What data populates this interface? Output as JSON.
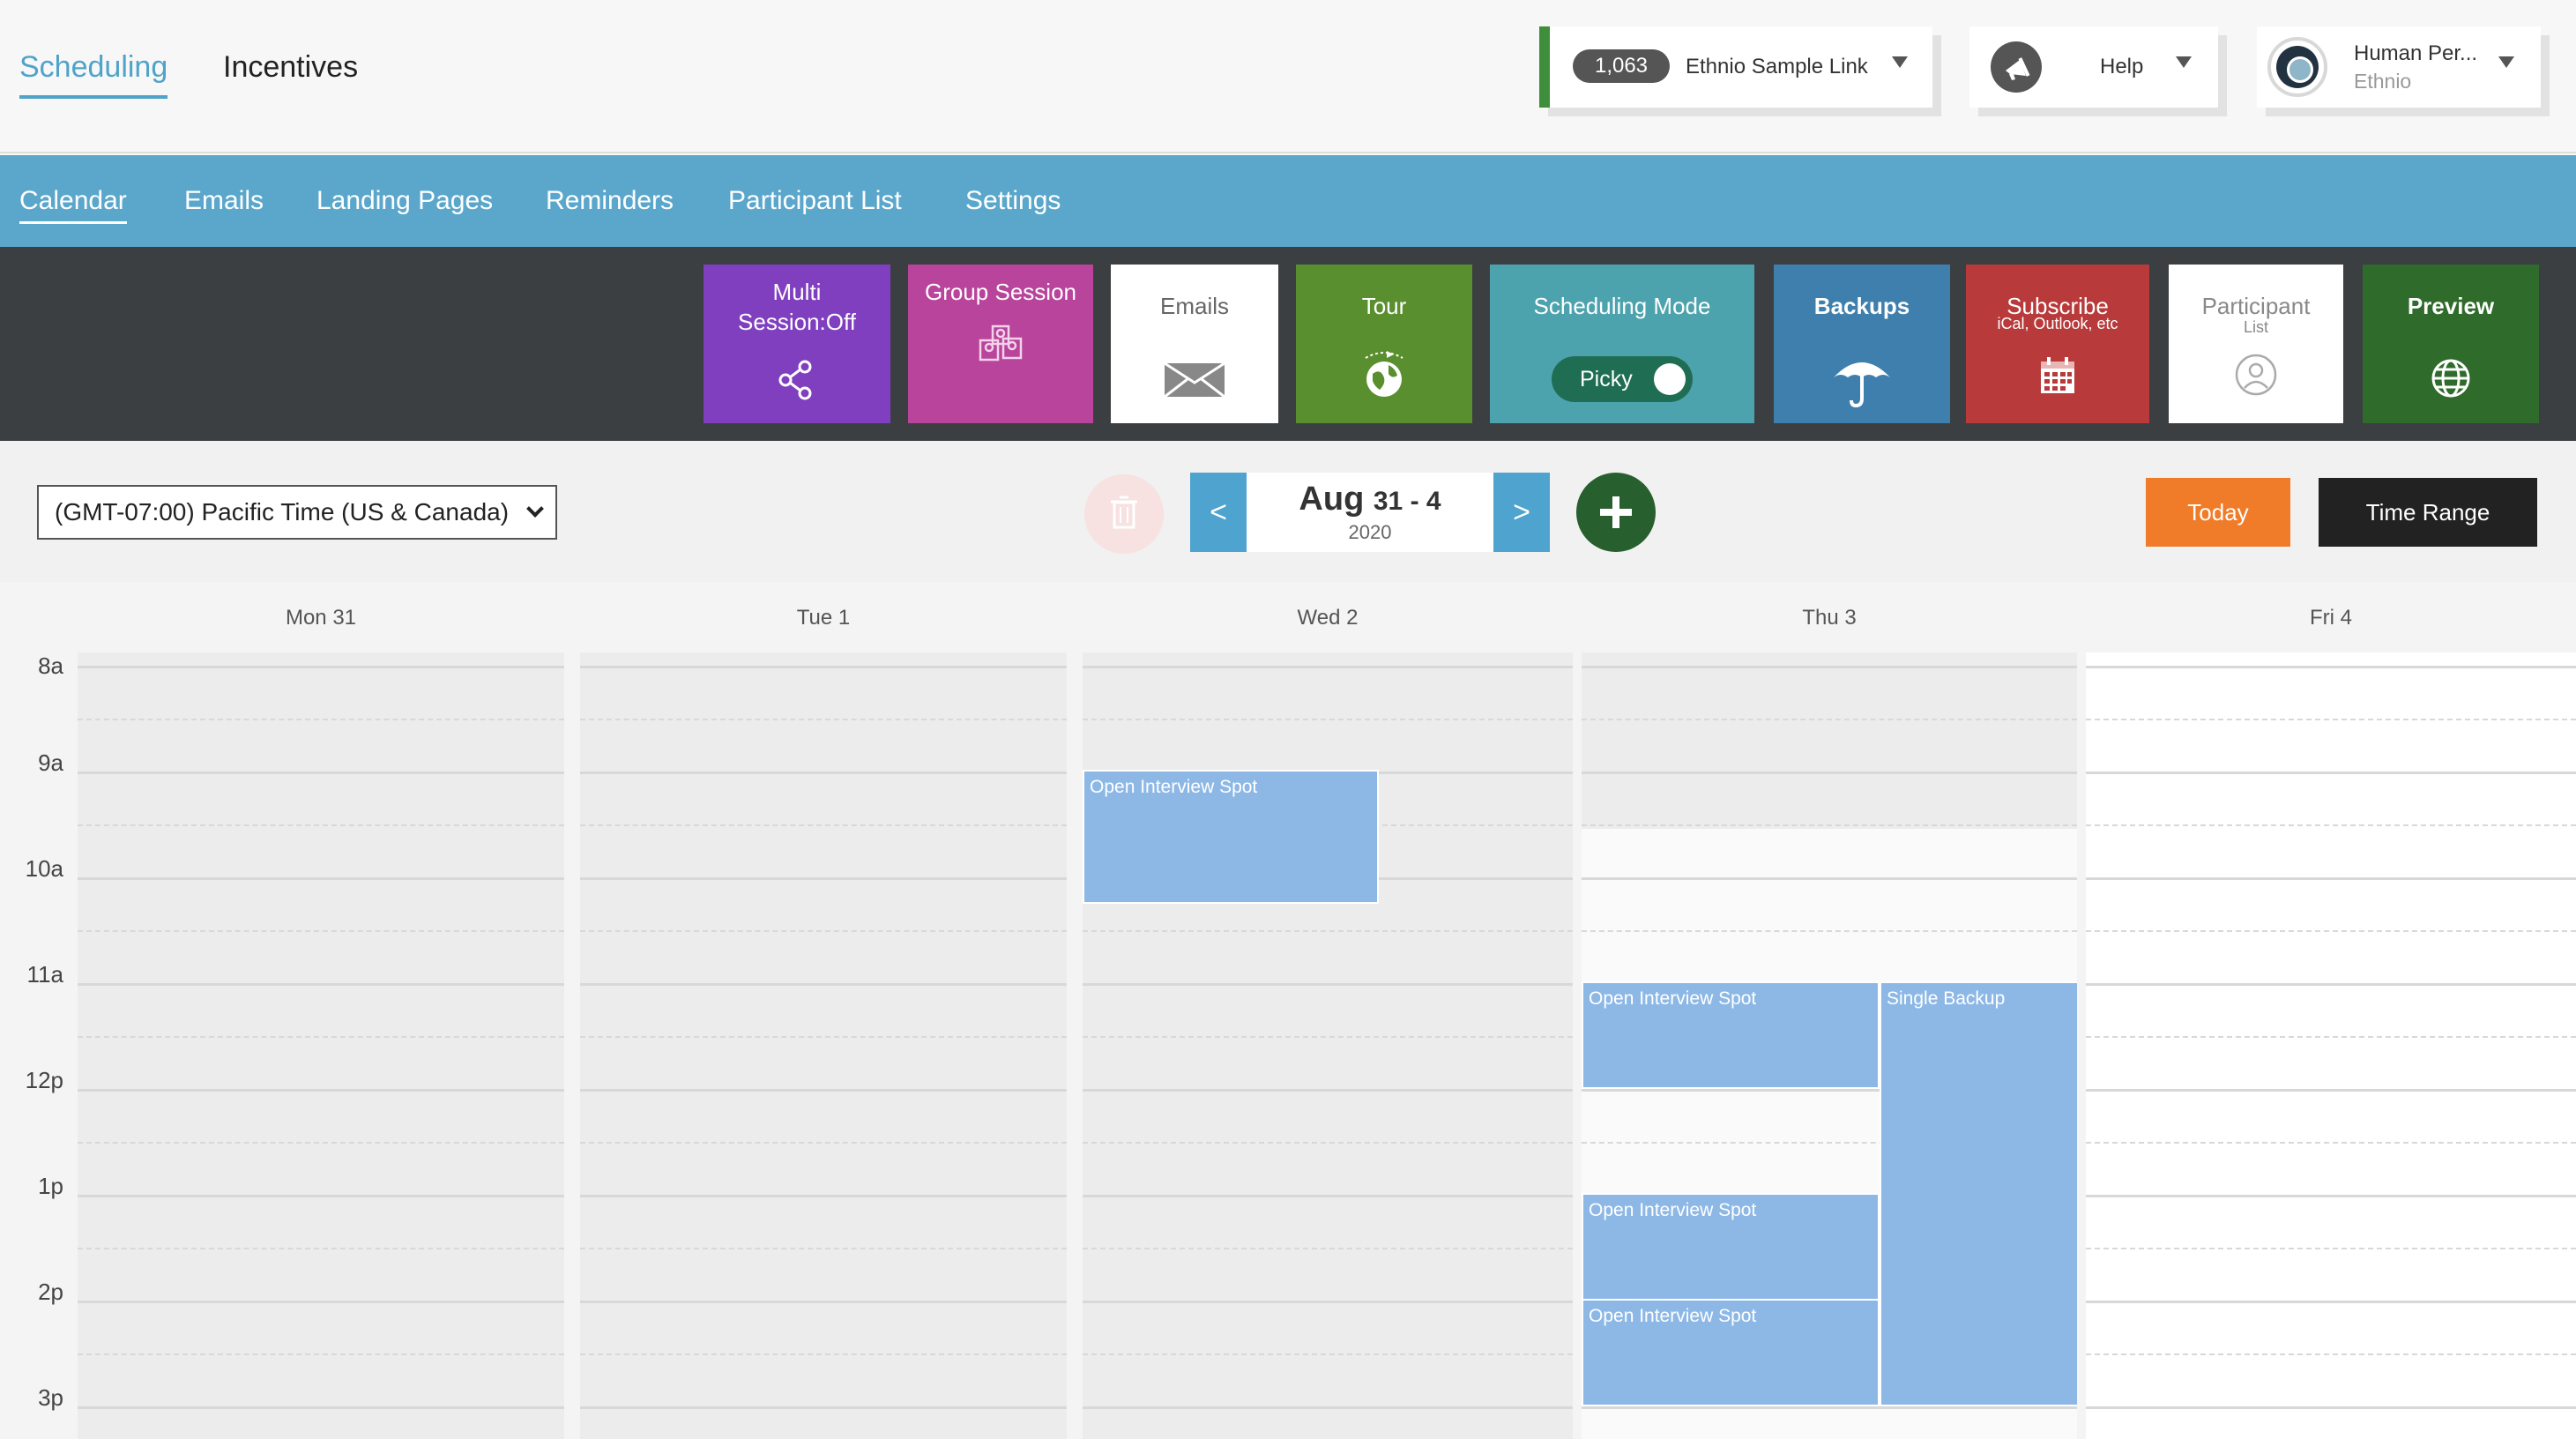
{
  "header": {
    "main_tabs": [
      {
        "label": "Scheduling",
        "active": true
      },
      {
        "label": "Incentives",
        "active": false
      }
    ],
    "link_selector": {
      "count": "1,063",
      "label": "Ethnio Sample Link"
    },
    "help": {
      "label": "Help",
      "icon": "megaphone-icon"
    },
    "user": {
      "name": "Human Per...",
      "org": "Ethnio"
    }
  },
  "subnav": {
    "tabs": [
      {
        "label": "Calendar",
        "active": true
      },
      {
        "label": "Emails",
        "active": false
      },
      {
        "label": "Landing Pages",
        "active": false
      },
      {
        "label": "Reminders",
        "active": false
      },
      {
        "label": "Participant List",
        "active": false
      },
      {
        "label": "Settings",
        "active": false
      }
    ]
  },
  "toolbar": {
    "multi_session": {
      "line1": "Multi",
      "line2": "Session:Off",
      "color": "#7f3fbf",
      "icon": "share-nodes-icon"
    },
    "group_session": {
      "label": "Group Session",
      "color": "#b8449b",
      "icon": "group-people-icon"
    },
    "emails": {
      "label": "Emails",
      "color": "#ffffff",
      "icon": "envelope-icon"
    },
    "tour": {
      "label": "Tour",
      "color": "#5a8f2f",
      "icon": "globe-plane-icon"
    },
    "scheduling_mode": {
      "label": "Scheduling Mode",
      "toggle_label": "Picky",
      "color": "#4da3ad"
    },
    "backups": {
      "label": "Backups",
      "color": "#3f7fad",
      "icon": "umbrella-icon"
    },
    "subscribe": {
      "label": "Subscribe",
      "sub": "iCal, Outlook, etc",
      "color": "#b83a3a",
      "icon": "calendar-icon"
    },
    "participant": {
      "label": "Participant",
      "sub": "List",
      "color": "#ffffff",
      "icon": "user-circle-icon"
    },
    "preview": {
      "label": "Preview",
      "color": "#2f6b2a",
      "icon": "globe-icon"
    }
  },
  "controls": {
    "timezone": "(GMT-07:00) Pacific Time (US & Canada)",
    "prev": "<",
    "next": ">",
    "date_month": "Aug",
    "date_range": "31 - 4",
    "date_year": "2020",
    "today": "Today",
    "time_range": "Time Range"
  },
  "calendar": {
    "days": [
      "Mon 31",
      "Tue 1",
      "Wed 2",
      "Thu 3",
      "Fri 4"
    ],
    "hours": [
      "8a",
      "9a",
      "10a",
      "11a",
      "12p",
      "1p",
      "2p",
      "3p"
    ],
    "events": [
      {
        "day": 2,
        "start": 9.0,
        "end": 10.25,
        "label": "Open Interview Spot",
        "lane": 0,
        "lanes": 1
      },
      {
        "day": 3,
        "start": 11.0,
        "end": 12.0,
        "label": "Open Interview Spot",
        "lane": 0,
        "lanes": 2
      },
      {
        "day": 3,
        "start": 11.0,
        "end": 15.0,
        "label": "Single Backup",
        "lane": 1,
        "lanes": 2
      },
      {
        "day": 3,
        "start": 13.0,
        "end": 14.0,
        "label": "Open Interview Spot",
        "lane": 0,
        "lanes": 2
      },
      {
        "day": 3,
        "start": 14.0,
        "end": 15.0,
        "label": "Open Interview Spot",
        "lane": 0,
        "lanes": 2
      }
    ]
  }
}
